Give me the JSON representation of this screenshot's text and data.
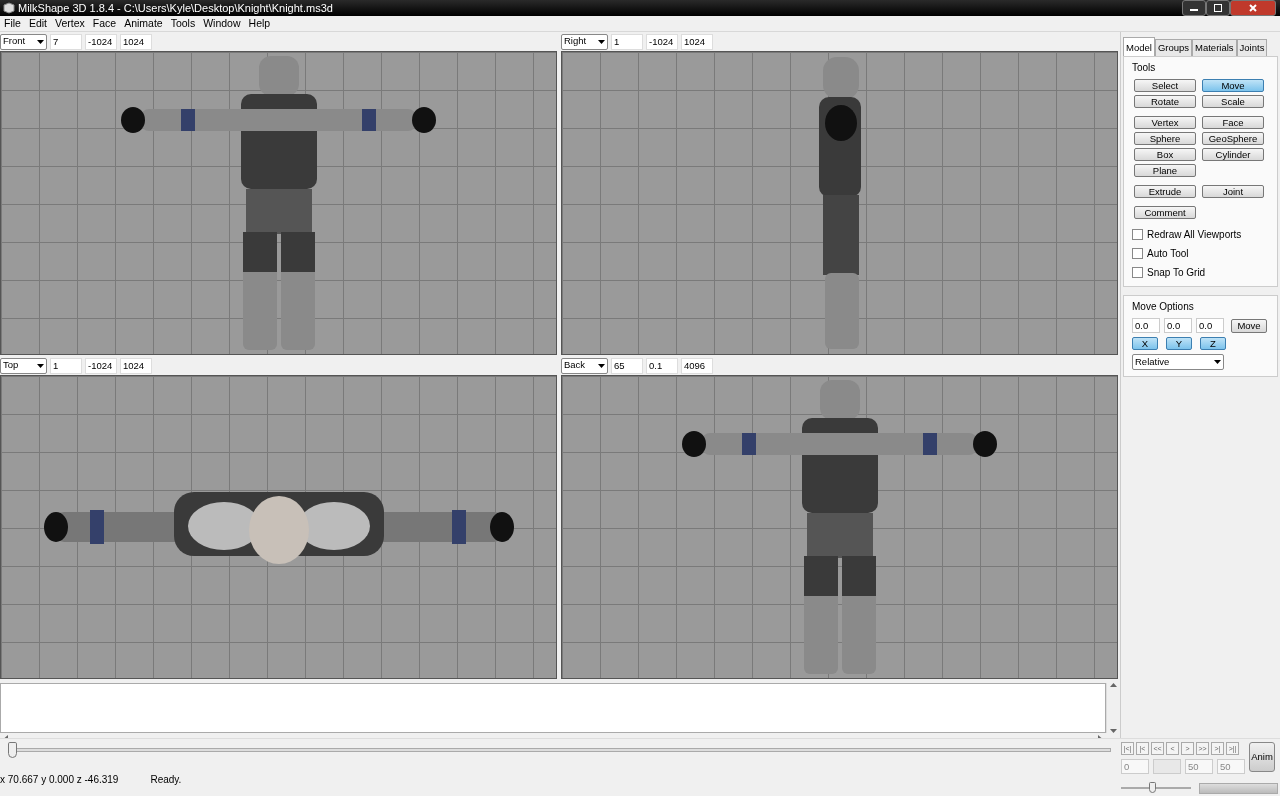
{
  "window": {
    "title": "MilkShape 3D 1.8.4 - C:\\Users\\Kyle\\Desktop\\Knight\\Knight.ms3d"
  },
  "menu": [
    "File",
    "Edit",
    "Vertex",
    "Face",
    "Animate",
    "Tools",
    "Window",
    "Help"
  ],
  "viewports": [
    {
      "view": "Front",
      "kind": "front",
      "field_1": "7",
      "field_2": "-1024",
      "field_3": "1024"
    },
    {
      "view": "Right",
      "kind": "side",
      "field_1": "1",
      "field_2": "-1024",
      "field_3": "1024"
    },
    {
      "view": "Top",
      "kind": "top",
      "field_1": "1",
      "field_2": "-1024",
      "field_3": "1024"
    },
    {
      "view": "Back",
      "kind": "back",
      "field_1": "65",
      "field_2": "0.1",
      "field_3": "4096"
    }
  ],
  "panel": {
    "tabs": [
      {
        "label": "Model",
        "selected": true
      },
      {
        "label": "Groups",
        "selected": false
      },
      {
        "label": "Materials",
        "selected": false
      },
      {
        "label": "Joints",
        "selected": false
      }
    ],
    "tools_title": "Tools",
    "tool_groups": [
      [
        {
          "label": "Select",
          "selected": false
        },
        {
          "label": "Move",
          "selected": true
        },
        {
          "label": "Rotate",
          "selected": false
        },
        {
          "label": "Scale",
          "selected": false
        }
      ],
      [
        {
          "label": "Vertex",
          "selected": false
        },
        {
          "label": "Face",
          "selected": false
        },
        {
          "label": "Sphere",
          "selected": false
        },
        {
          "label": "GeoSphere",
          "selected": false
        },
        {
          "label": "Box",
          "selected": false
        },
        {
          "label": "Cylinder",
          "selected": false
        },
        {
          "label": "Plane",
          "selected": false
        }
      ],
      [
        {
          "label": "Extrude",
          "selected": false
        },
        {
          "label": "Joint",
          "selected": false
        }
      ],
      [
        {
          "label": "Comment",
          "selected": false
        }
      ]
    ],
    "checkboxes": [
      {
        "label": "Redraw All Viewports",
        "checked": false
      },
      {
        "label": "Auto Tool",
        "checked": false
      },
      {
        "label": "Snap To Grid",
        "checked": false
      }
    ],
    "options_title": "Move Options",
    "fields": [
      "0.0",
      "0.0",
      "0.0"
    ],
    "apply_button": "Move",
    "axes": [
      {
        "label": "X",
        "selected": true
      },
      {
        "label": "Y",
        "selected": true
      },
      {
        "label": "Z",
        "selected": true
      }
    ],
    "mode": "Relative"
  },
  "timeline": {
    "level": 0
  },
  "anim": {
    "nav": [
      "|<|",
      "|<",
      "<<",
      "<",
      ">",
      ">>",
      ">|",
      ">||"
    ],
    "frames": [
      {
        "kind": "value",
        "value": "0"
      },
      {
        "kind": "blank"
      },
      {
        "kind": "value",
        "value": "50"
      },
      {
        "kind": "value",
        "value": "50"
      }
    ],
    "button": "Anim",
    "speed": {
      "level": 0.45
    },
    "progress": {
      "level": 0
    }
  },
  "status_bar": {
    "coords": "x 70.667 y 0.000 z -46.319",
    "message": "Ready."
  }
}
